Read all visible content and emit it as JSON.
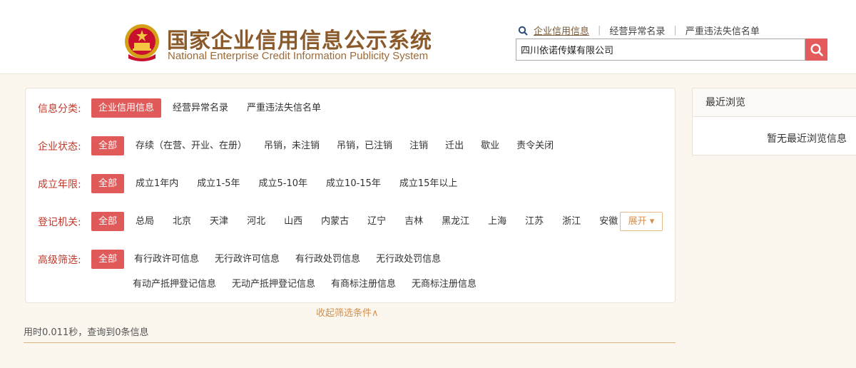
{
  "header": {
    "title_cn": "国家企业信用信息公示系统",
    "title_en": "National Enterprise Credit Information Publicity System",
    "links": [
      {
        "label": "企业信用信息",
        "active": true
      },
      {
        "label": "经营异常名录",
        "active": false
      },
      {
        "label": "严重违法失信名单",
        "active": false
      }
    ],
    "search_value": "四川依诺传媒有限公司"
  },
  "filters": {
    "category": {
      "label": "信息分类:",
      "options": [
        "企业信用信息",
        "经营异常名录",
        "严重违法失信名单"
      ]
    },
    "status": {
      "label": "企业状态:",
      "options": [
        "全部",
        "存续（在营、开业、在册）",
        "吊销，未注销",
        "吊销，已注销",
        "注销",
        "迁出",
        "歇业",
        "责令关闭"
      ]
    },
    "age": {
      "label": "成立年限:",
      "options": [
        "全部",
        "成立1年内",
        "成立1-5年",
        "成立5-10年",
        "成立10-15年",
        "成立15年以上"
      ]
    },
    "authority": {
      "label": "登记机关:",
      "options": [
        "全部",
        "总局",
        "北京",
        "天津",
        "河北",
        "山西",
        "内蒙古",
        "辽宁",
        "吉林",
        "黑龙江",
        "上海",
        "江苏",
        "浙江",
        "安徽"
      ],
      "expand_label": "展开 ▾"
    },
    "advanced": {
      "label": "高级筛选:",
      "options_row1": [
        "全部",
        "有行政许可信息",
        "无行政许可信息",
        "有行政处罚信息",
        "无行政处罚信息"
      ],
      "options_row2": [
        "有动产抵押登记信息",
        "无动产抵押登记信息",
        "有商标注册信息",
        "无商标注册信息"
      ]
    },
    "collapse_label": "收起筛选条件∧"
  },
  "results": {
    "stats": "用时0.011秒，查询到0条信息"
  },
  "sidebar": {
    "title": "最近浏览",
    "empty_text": "暂无最近浏览信息"
  },
  "colors": {
    "accent_red": "#e05a5a",
    "label_red": "#c0392b",
    "gold": "#d4904e",
    "title_brown": "#8b5a2b"
  }
}
